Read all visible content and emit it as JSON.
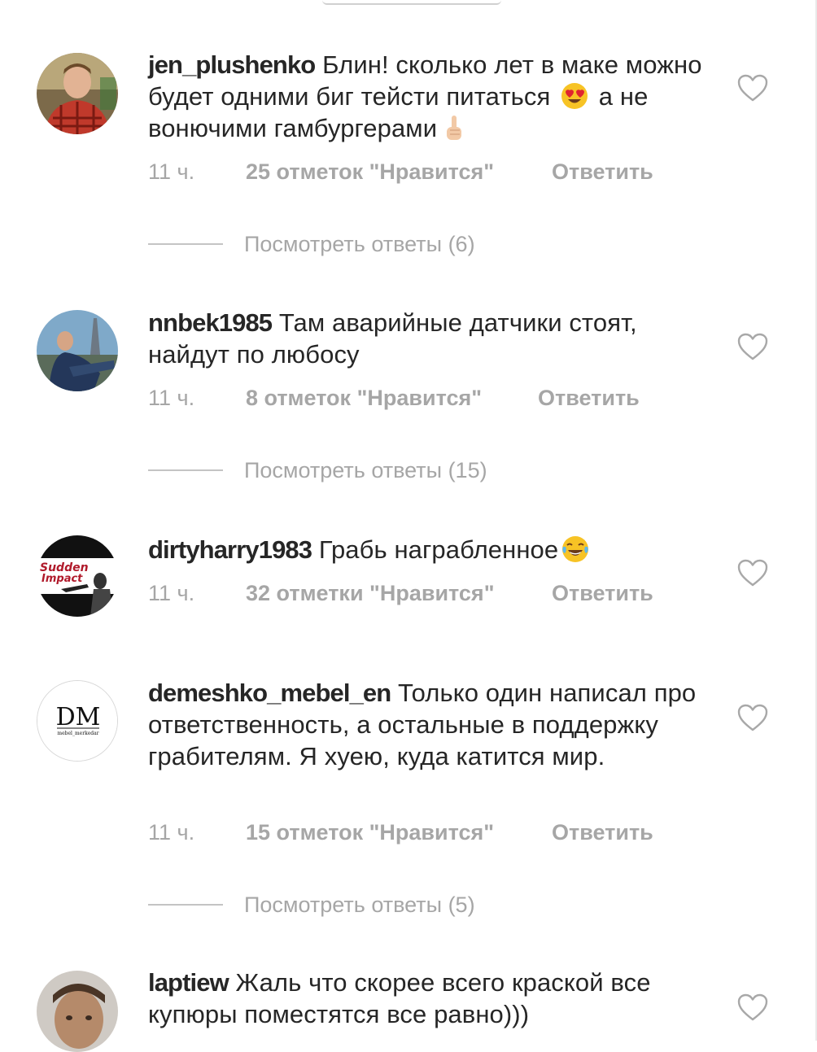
{
  "reply_action": "Ответить",
  "comments": [
    {
      "username": "jen_plushenko",
      "text_part1": "Блин! сколько лет в маке можно будет одними биг тейсти питаться ",
      "text_part2": " а не вонючими гамбургерами",
      "emoji1": "heart-eyes-emoji",
      "emoji2": "index-pointing-up-emoji",
      "time": "11 ч.",
      "likes": "25 отметок \"Нравится\"",
      "view_replies": "Посмотреть ответы (6)"
    },
    {
      "username": "nnbek1985",
      "text": "Там аварийные датчики стоят, найдут по любосу",
      "time": "11 ч.",
      "likes": "8 отметок \"Нравится\"",
      "view_replies": "Посмотреть ответы (15)"
    },
    {
      "username": "dirtyharry1983",
      "text": "Грабь награбленное",
      "emoji1": "tears-of-joy-emoji",
      "avatar_text": [
        "Sudden",
        "Impact"
      ],
      "time": "11 ч.",
      "likes": "32 отметки \"Нравится\""
    },
    {
      "username": "demeshko_mebel_en",
      "text": "Только один написал про ответственность, а остальные в поддержку грабителям. Я хуею, куда катится мир.",
      "avatar_text": [
        "DM",
        "mebel_merkedar"
      ],
      "time": "11 ч.",
      "likes": "15 отметок \"Нравится\"",
      "view_replies": "Посмотреть ответы (5)"
    },
    {
      "username": "laptiew",
      "text": "Жаль что скорее всего краской все купюры поместятся все равно)))"
    }
  ]
}
